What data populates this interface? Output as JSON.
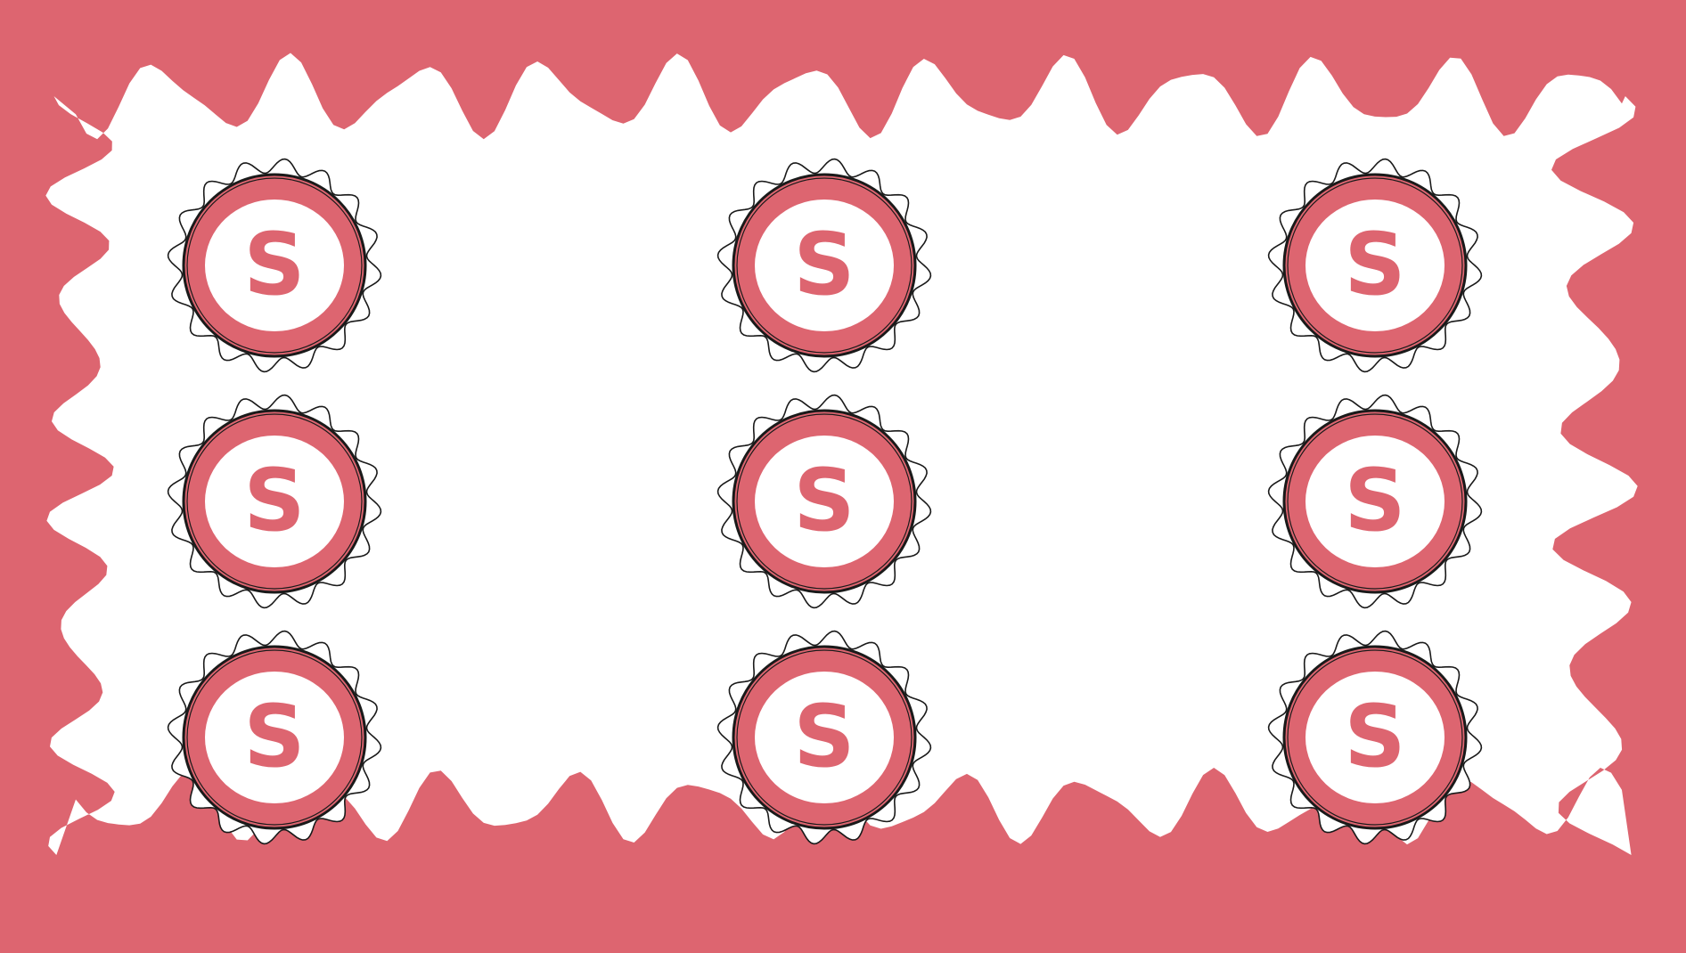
{
  "colors": {
    "frame": "#dd6570",
    "inner": "#ffffff",
    "outline": "#1a1a1a",
    "badge_fill": "#dd6570",
    "badge_center": "#ffffff",
    "letter": "#dd6570"
  },
  "badges": {
    "rows": 3,
    "columns": 3,
    "letter": "S",
    "count": 9
  }
}
